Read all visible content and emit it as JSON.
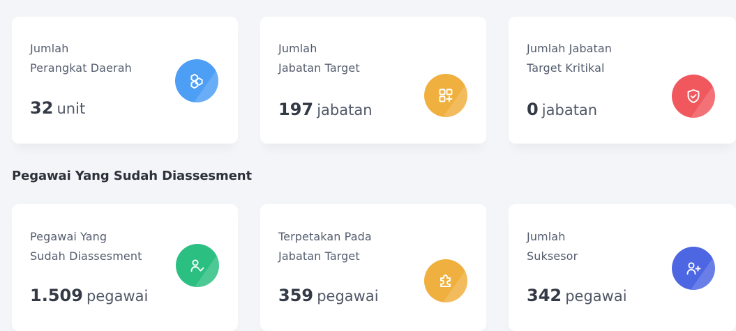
{
  "top_cards": [
    {
      "label_line1": "Jumlah",
      "label_line2": "Perangkat Daerah",
      "value": "32",
      "unit": "unit",
      "icon": "hexagon-cluster-icon",
      "color": "#4d9ef5"
    },
    {
      "label_line1": "Jumlah",
      "label_line2": "Jabatan Target",
      "value": "197",
      "unit": "jabatan",
      "icon": "grid-add-icon",
      "color": "#f0b03f"
    },
    {
      "label_line1": "Jumlah Jabatan",
      "label_line2": "Target Kritikal",
      "value": "0",
      "unit": "jabatan",
      "icon": "shield-check-icon",
      "color": "#f0585e"
    }
  ],
  "section_title": "Pegawai Yang Sudah Diassesment",
  "bottom_cards": [
    {
      "label_line1": "Pegawai Yang",
      "label_line2": "Sudah Diassesment",
      "value": "1.509",
      "unit": "pegawai",
      "icon": "user-check-icon",
      "color": "#2cbf82"
    },
    {
      "label_line1": "Terpetakan Pada",
      "label_line2": "Jabatan Target",
      "value": "359",
      "unit": "pegawai",
      "icon": "puzzle-icon",
      "color": "#f0b03f"
    },
    {
      "label_line1": "Jumlah",
      "label_line2": "Suksesor",
      "value": "342",
      "unit": "pegawai",
      "icon": "user-plus-icon",
      "color": "#4d67e3"
    }
  ]
}
